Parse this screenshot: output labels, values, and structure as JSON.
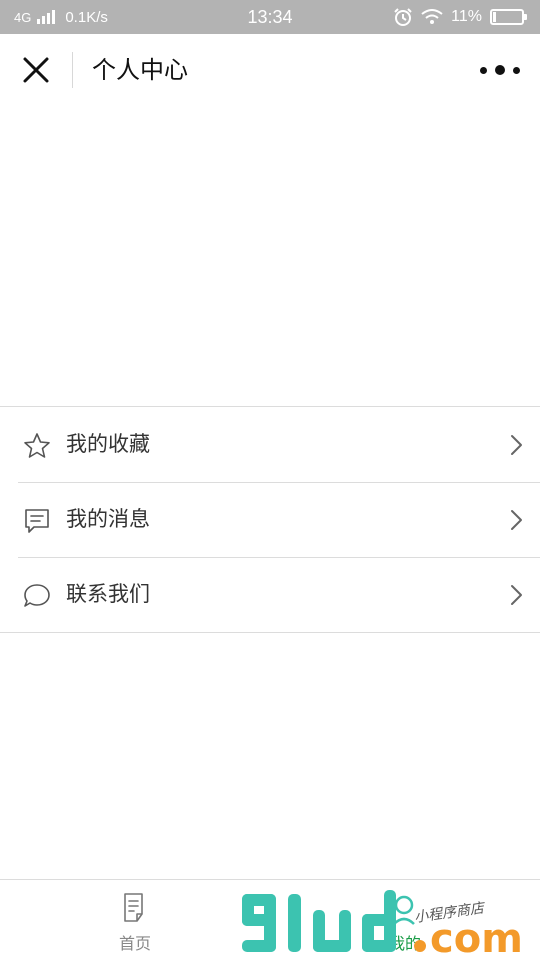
{
  "status_bar": {
    "network": "4G",
    "speed": "0.1K/s",
    "time": "13:34",
    "battery_text": "11%",
    "battery_level": 0.11
  },
  "nav": {
    "title": "个人中心"
  },
  "menu": {
    "items": [
      {
        "label": "我的收藏",
        "icon": "star-icon"
      },
      {
        "label": "我的消息",
        "icon": "message-icon"
      },
      {
        "label": "联系我们",
        "icon": "chat-bubble-icon"
      }
    ]
  },
  "tabbar": {
    "items": [
      {
        "label": "首页",
        "icon": "document-icon"
      },
      {
        "label": "我的",
        "icon": "user-icon"
      }
    ]
  },
  "watermark": {
    "brand": "91ud",
    "domain": ".com",
    "tagline": "小程序商店"
  },
  "colors": {
    "status_bar_bg": "#b3b3b3",
    "accent_green": "#1a9c47",
    "watermark_teal": "#3cc3b0",
    "watermark_orange": "#f39a2a"
  }
}
